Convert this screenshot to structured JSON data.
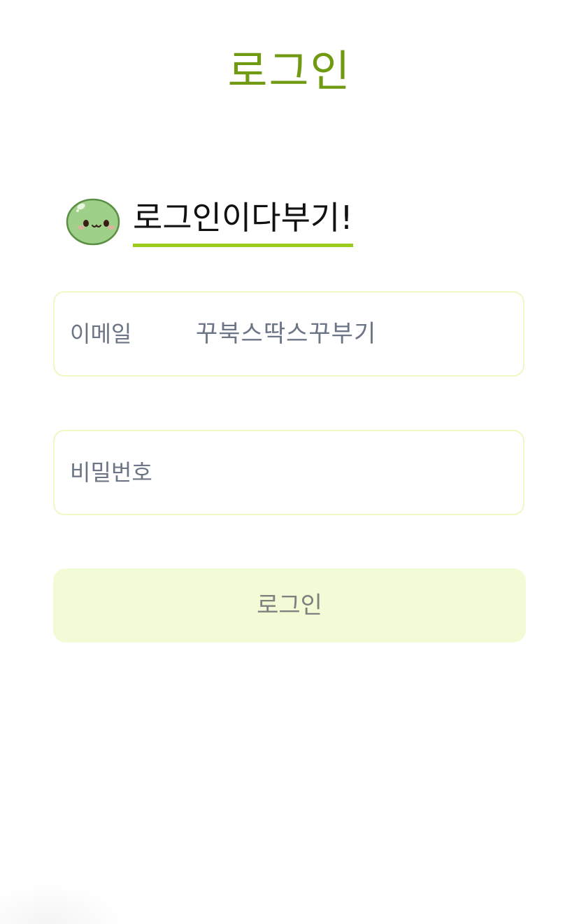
{
  "header": {
    "title": "로그인"
  },
  "greeting": {
    "text": "로그인이다부기!",
    "mascot_icon": "green-slime-mascot-icon"
  },
  "form": {
    "email": {
      "label": "이메일",
      "value": "꾸북스딱스꾸부기"
    },
    "password": {
      "label": "비밀번호",
      "value": ""
    },
    "submit_label": "로그인"
  },
  "colors": {
    "title": "#6f9a12",
    "underline": "#9acd1e",
    "field_border": "#eef9c4",
    "button_bg": "#f1fcd6",
    "mascot_fill": "#9fd08a"
  }
}
